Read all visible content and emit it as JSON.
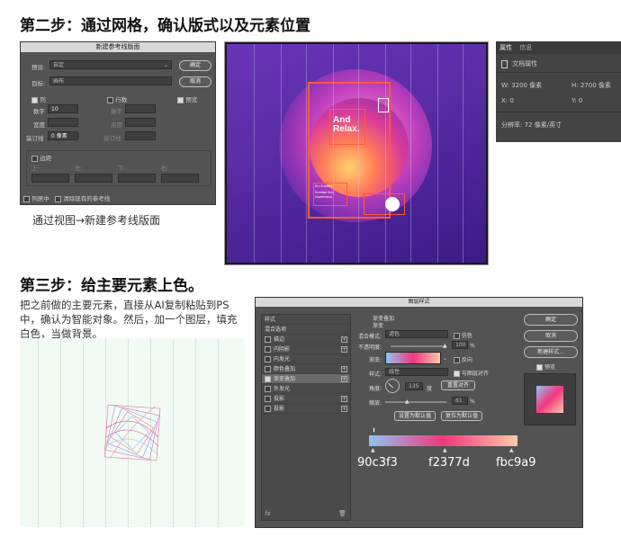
{
  "step2": {
    "title": "第二步：通过网格，确认版式以及元素位置",
    "caption": "通过视图→新建参考线版面",
    "dialog": {
      "title": "新建参考线版面",
      "preset_label": "预设:",
      "preset_value": "自定",
      "target_label": "目标:",
      "target_value": "画布",
      "ok": "确定",
      "cancel": "取消",
      "preview": "预览",
      "columns": "列",
      "rows": "行数",
      "number_label": "数字",
      "number_value": "10",
      "width_label": "宽度",
      "gutter_label": "装订线",
      "gutter_value": "0 像素",
      "rows_number": "数字",
      "rows_height": "高度",
      "rows_gutter": "装订线",
      "margin": "边距",
      "top": "上:",
      "left": "左:",
      "bottom": "下:",
      "right": "右:",
      "center_cols": "列居中",
      "clear_guides": "清除现有的参考线"
    },
    "properties": {
      "tab1": "属性",
      "tab2": "信息",
      "doc": "文档属性",
      "w": "W: 3200 像素",
      "h": "H: 2700 像素",
      "x": "X: 0",
      "y": "Y: 0",
      "res": "分辨率: 72 像素/英寸"
    },
    "poster": {
      "headline1": "And",
      "headline2": "Relax.",
      "small1": "It's Sunday",
      "small2": "Sunday Sun Sweetness"
    }
  },
  "step3": {
    "title": "第三步：给主要元素上色。",
    "description": "把之前做的主要元素，直接从AI复制粘贴到PS中，确认为智能对象。然后，加一个图层，填充白色，当做背景。",
    "layer_style": {
      "title": "图层样式",
      "styles_header": "样式",
      "blend_options": "混合选项",
      "items": [
        "描边",
        "内阴影",
        "内发光",
        "颜色叠加",
        "渐变叠加",
        "外发光",
        "投影",
        "投影"
      ],
      "checked_index": 4,
      "section": "渐变叠加",
      "sub": "渐变",
      "blend_mode_label": "混合模式:",
      "blend_mode": "滤色",
      "dither": "仿色",
      "opacity_label": "不透明度:",
      "opacity": "100",
      "percent": "%",
      "gradient_label": "渐变:",
      "reverse": "反向",
      "style_label": "样式:",
      "style_value": "线性",
      "align": "与图层对齐",
      "angle_label": "角度:",
      "angle": "135",
      "degree": "度",
      "reset_align": "重置对齐",
      "scale_label": "缩放:",
      "scale": "61",
      "set_default": "设置为默认值",
      "reset_default": "复位为默认值",
      "ok": "确定",
      "cancel": "取消",
      "new_style": "新建样式...",
      "preview": "预览",
      "fx": "fx"
    },
    "colors": {
      "c1_label": "90c3f3",
      "c2_label": "f2377d",
      "c3_label": "fbc9a9",
      "c1": "#90c3f3",
      "c2": "#f2377d",
      "c3": "#fbc9a9"
    }
  }
}
